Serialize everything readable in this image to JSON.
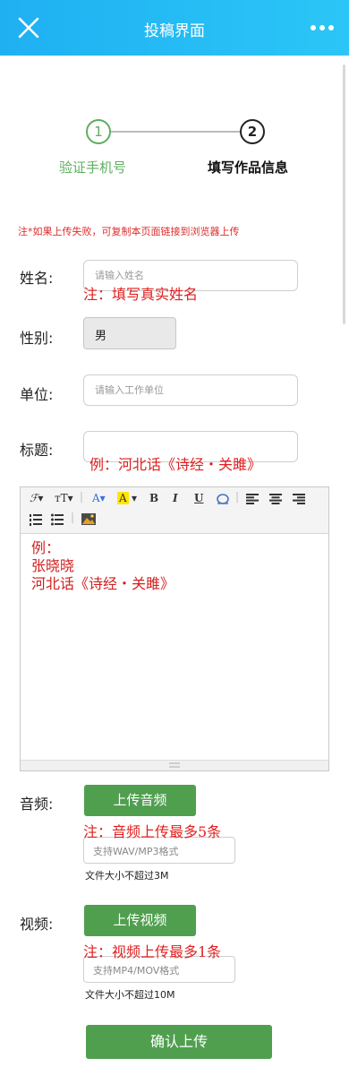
{
  "header": {
    "title": "投稿界面"
  },
  "steps": [
    {
      "number": "1",
      "label": "验证手机号"
    },
    {
      "number": "2",
      "label": "填写作品信息"
    }
  ],
  "notice": "注*如果上传失败，可复制本页面链接到浏览器上传",
  "form": {
    "name": {
      "label": "姓名:",
      "placeholder": "请输入姓名",
      "hint": "注：填写真实姓名"
    },
    "gender": {
      "label": "性别:",
      "value": "男"
    },
    "unit": {
      "label": "单位:",
      "placeholder": "请输入工作单位"
    },
    "title": {
      "label": "标题:",
      "hint": "例：河北话《诗经・关雎》"
    }
  },
  "editor": {
    "lines": [
      "例：",
      "张晓晓",
      "河北话《诗经・关雎》"
    ]
  },
  "audio": {
    "label": "音频:",
    "button": "上传音频",
    "hint": "注：音频上传最多5条",
    "file_placeholder": "支持WAV/MP3格式",
    "limit": "文件大小不超过3M"
  },
  "video": {
    "label": "视频:",
    "button": "上传视频",
    "hint": "注：视频上传最多1条",
    "file_placeholder": "支持MP4/MOV格式",
    "limit": "文件大小不超过10M"
  },
  "submit": "确认上传"
}
